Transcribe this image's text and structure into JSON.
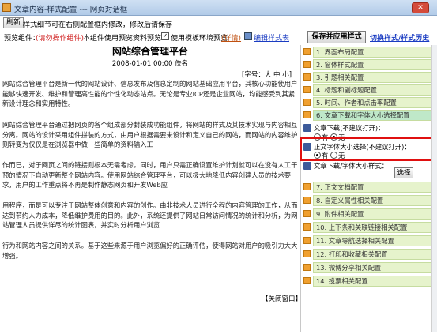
{
  "window": {
    "title": "文章内容-样式配置 --- 网页对话框",
    "close": "✕"
  },
  "toolbar": {
    "refresh_label": "刷新",
    "hint": "样式细节可在右侧配置框内修改，修改后请保存",
    "preview_label": "预览组件：",
    "preview_value": "(请勿操作组件)",
    "preview_note": "本组件使用预览资料预览",
    "template_check_label": "使用模板环境预览",
    "details_link": "(详情)",
    "edit_style_link": "编辑样式表",
    "save_apply": "保存并应用样式",
    "switch_history": "切换样式/样式历史"
  },
  "doc": {
    "title": "网站综合管理平台",
    "meta": "2008-01-01  00:00    佚名",
    "font_size": "[字号：大  中  小]",
    "paragraphs": [
      "网站综合管理平台是新一代的网站设计、信息发布及信息定制的网站基础应用平台，其核心功能使用户能够快速开发、维护和管理高性能的个性化动态站点。无论是专业ICP还是企业网站，均能感受到其紧新设计理念和实用特性。",
      "    网站综合管理平台通过把网页的各个组成部分封装成功能组件，将网站的样式及其技术实现与内容相互分离。网站的设计采用组件拼装的方式，由用户根据需要来设计和定义自己的网站，而网站的内容维护则转变为仅仅是在浏览器中做一些简单的资料输入工",
      "    作而已，对于网页之间的链接则根本无需考虑。同时，用户只需正确设置维护计划就可以在没有人工干预的情况下自动更新整个网站内容。使用网站综合管理平台，可以极大地降低内容创建人员的技术要求，用户的工作重点将不再是制作静态网页和开发Web应",
      "    用程序，而是可以专注于网站整体创意和内容的创作。由非技术人员进行全程的内容管理的工作，从而达到节约人力成本，降低维护费用的目的。此外，系统还提供了网站日常访问情况的统计和分析，为网站管理人员提供详尽的统计图表，并实时分析用户浏览",
      "    行为和网站内容之间的关系。基于这些来源于用户浏览偏好的正确评估，使得网站对用户的吸引力大大增强。"
    ],
    "close_link": "【关闭窗口】"
  },
  "sidebar": {
    "items_top": [
      "1. 界面布局配置",
      "2. 窗体样式配置",
      "3. 引题相关配置",
      "4. 标题和副标题配置",
      "5. 时间、作者和点击率配置",
      "6. 文章下载和字体大小选择配置"
    ],
    "download_label": "文章下载(不建议打开)：",
    "download_yes": "有",
    "download_no": "无",
    "font_choice_label": "正文字体大小选择(不建议打开)：",
    "font_choice_yes": "有",
    "font_choice_no": "无",
    "download_style_label": "文章下载/字体大小样式：",
    "choose_button": "选择",
    "items_bottom": [
      "7. 正文文档配置",
      "8. 自定义属性相关配置",
      "9. 附件相关配置",
      "10. 上下条和关联链接相关配置",
      "11. 文章导航选择相关配置",
      "12. 打印和收藏相关配置",
      "13. 微博分享相关配置",
      "14. 投票相关配置"
    ]
  }
}
